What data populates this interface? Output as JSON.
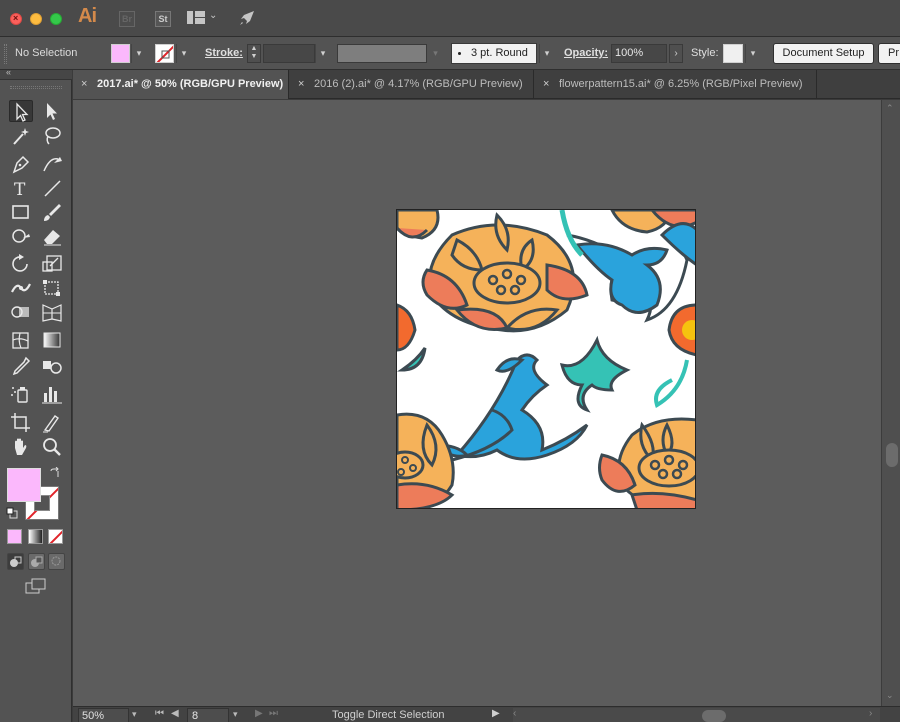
{
  "app": {
    "logo": "Ai",
    "bridge_label": "Br",
    "stock_label": "St",
    "icons": [
      "workspace-switcher-icon",
      "gpu-performance-rocket-icon"
    ]
  },
  "control_bar": {
    "selection_status": "No Selection",
    "fill_color": "#fbb8fc",
    "stroke_color": "none",
    "stroke_label": "Stroke:",
    "stroke_weight": "",
    "brush": "3 pt. Round",
    "opacity_label": "Opacity:",
    "opacity": "100%",
    "style_label": "Style:",
    "document_setup": "Document Setup",
    "preferences": "Pr"
  },
  "tabs": [
    {
      "label": "2017.ai* @ 50% (RGB/GPU Preview)",
      "active": true
    },
    {
      "label": "2016 (2).ai* @ 4.17% (RGB/GPU Preview)",
      "active": false
    },
    {
      "label": "flowerpattern15.ai* @ 6.25% (RGB/Pixel Preview)",
      "active": false
    }
  ],
  "tools": [
    "selection-tool",
    "direct-selection-tool",
    "magic-wand-tool",
    "lasso-tool",
    "pen-tool",
    "curvature-tool",
    "type-tool",
    "line-segment-tool",
    "rectangle-tool",
    "paintbrush-tool",
    "shaper-tool",
    "eraser-tool",
    "rotate-tool",
    "scale-tool",
    "width-tool",
    "free-transform-tool",
    "shape-builder-tool",
    "perspective-grid-tool",
    "mesh-tool",
    "gradient-tool",
    "eyedropper-tool",
    "blend-tool",
    "symbol-sprayer-tool",
    "column-graph-tool",
    "artboard-tool",
    "slice-tool",
    "hand-tool",
    "zoom-tool"
  ],
  "tool_colors": {
    "fill": "#fbb8fc",
    "stroke": "none"
  },
  "artwork": {
    "petal_orange": "#f5b25a",
    "petal_coral": "#ed7c5a",
    "leaf_blue": "#2aa3dc",
    "leaf_teal": "#35c2b5",
    "outline": "#3c4a52",
    "flower_red": "#f26a2e",
    "center_yellow": "#f6c20f"
  },
  "status_bar": {
    "zoom": "50%",
    "artboard_number": "8",
    "status_text": "Toggle Direct Selection"
  }
}
